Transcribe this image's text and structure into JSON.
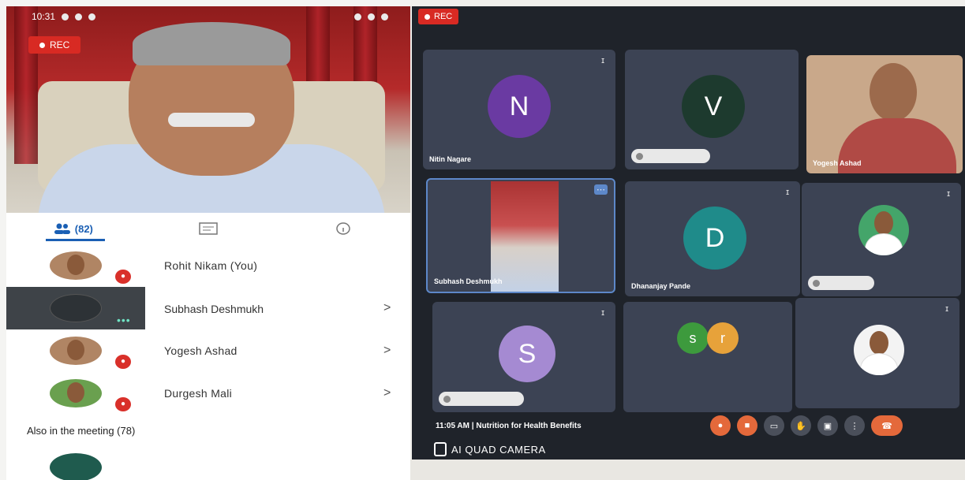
{
  "phone": {
    "status_time": "10:31",
    "rec_label": "REC",
    "tabs": [
      {
        "label": "(82)",
        "icon": "people-icon"
      },
      {
        "label": "",
        "icon": "chat-icon"
      },
      {
        "label": "",
        "icon": "info-icon"
      }
    ],
    "participants": [
      {
        "name": "Rohit Nikam (You)",
        "arrow": ""
      },
      {
        "name": "Subhash Deshmukh",
        "arrow": ">"
      },
      {
        "name": "Yogesh Ashad",
        "arrow": ">"
      },
      {
        "name": "Durgesh Mali",
        "arrow": ">"
      }
    ],
    "also_label": "Also in the meeting (78)"
  },
  "meet": {
    "rec_label": "REC",
    "tiles": [
      {
        "initial": "N",
        "name": "Nitin Nagare"
      },
      {
        "initial": "V",
        "name": ""
      },
      {
        "initial": "",
        "name": "Yogesh Ashad"
      },
      {
        "initial": "",
        "name": "Subhash Deshmukh"
      },
      {
        "initial": "D",
        "name": "Dhananjay Pande"
      },
      {
        "initial": "",
        "name": ""
      },
      {
        "initial": "S",
        "name": ""
      },
      {
        "initial": "s r",
        "name": ""
      },
      {
        "initial": "",
        "name": ""
      }
    ],
    "meeting_time": "11:05 AM",
    "meeting_title": "Nutrition for Health Benefits",
    "watermark": "AI QUAD CAMERA",
    "colors": {
      "tile_bg": "#3c4354",
      "n_avatar": "#6a3aa2",
      "v_avatar": "#1d3a2e",
      "d_avatar": "#1f8b8a",
      "s_avatar": "#a58ad2",
      "s2_avatar": "#3d9a3d",
      "r_avatar": "#e7a23a",
      "rec": "#d82a23",
      "end_call": "#e4693b"
    }
  }
}
